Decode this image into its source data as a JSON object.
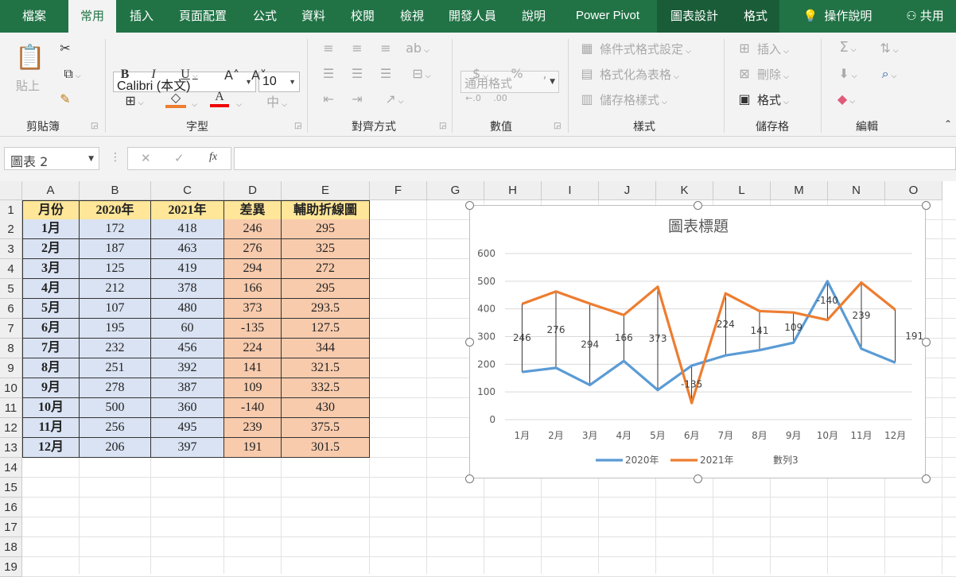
{
  "tabs": [
    "檔案",
    "常用",
    "插入",
    "頁面配置",
    "公式",
    "資料",
    "校閱",
    "檢視",
    "開發人員",
    "說明",
    "Power Pivot",
    "圖表設計",
    "格式"
  ],
  "tell_me": "操作說明",
  "share": "共用",
  "ribbon": {
    "paste": "貼上",
    "font_name": "Calibri (本文)",
    "font_size": "10",
    "number_format": "通用格式",
    "cond_format": "條件式格式設定",
    "format_table": "格式化為表格",
    "cell_styles": "儲存格樣式",
    "insert": "插入",
    "delete": "刪除",
    "format": "格式",
    "groups": [
      "剪貼簿",
      "字型",
      "對齊方式",
      "數值",
      "樣式",
      "儲存格",
      "編輯"
    ]
  },
  "namebox": "圖表 2",
  "columns": [
    "A",
    "B",
    "C",
    "D",
    "E",
    "F",
    "G",
    "H",
    "I",
    "J",
    "K",
    "L",
    "M",
    "N",
    "O"
  ],
  "rows": [
    "1",
    "2",
    "3",
    "4",
    "5",
    "6",
    "7",
    "8",
    "9",
    "10",
    "11",
    "12",
    "13",
    "14",
    "15",
    "16",
    "17",
    "18",
    "19"
  ],
  "table": {
    "headers": [
      "月份",
      "2020年",
      "2021年",
      "差異",
      "輔助折線圖"
    ],
    "data": [
      [
        "1月",
        "172",
        "418",
        "246",
        "295"
      ],
      [
        "2月",
        "187",
        "463",
        "276",
        "325"
      ],
      [
        "3月",
        "125",
        "419",
        "294",
        "272"
      ],
      [
        "4月",
        "212",
        "378",
        "166",
        "295"
      ],
      [
        "5月",
        "107",
        "480",
        "373",
        "293.5"
      ],
      [
        "6月",
        "195",
        "60",
        "-135",
        "127.5"
      ],
      [
        "7月",
        "232",
        "456",
        "224",
        "344"
      ],
      [
        "8月",
        "251",
        "392",
        "141",
        "321.5"
      ],
      [
        "9月",
        "278",
        "387",
        "109",
        "332.5"
      ],
      [
        "10月",
        "500",
        "360",
        "-140",
        "430"
      ],
      [
        "11月",
        "256",
        "495",
        "239",
        "375.5"
      ],
      [
        "12月",
        "206",
        "397",
        "191",
        "301.5"
      ]
    ]
  },
  "chart_data": {
    "type": "line",
    "title": "圖表標題",
    "categories": [
      "1月",
      "2月",
      "3月",
      "4月",
      "5月",
      "6月",
      "7月",
      "8月",
      "9月",
      "10月",
      "11月",
      "12月"
    ],
    "ylim": [
      0,
      600
    ],
    "yticks": [
      "0",
      "100",
      "200",
      "300",
      "400",
      "500",
      "600"
    ],
    "series": [
      {
        "name": "2020年",
        "color": "#5b9bd5",
        "values": [
          172,
          187,
          125,
          212,
          107,
          195,
          232,
          251,
          278,
          500,
          256,
          206
        ]
      },
      {
        "name": "2021年",
        "color": "#ed7d31",
        "values": [
          418,
          463,
          419,
          378,
          480,
          60,
          456,
          392,
          387,
          360,
          495,
          397
        ]
      },
      {
        "name": "數列3",
        "values": [
          295,
          325,
          272,
          295,
          293.5,
          127.5,
          344,
          321.5,
          332.5,
          430,
          375.5,
          301.5
        ]
      }
    ],
    "labels": [
      "246",
      "276",
      "294",
      "166",
      "373",
      "-135",
      "224",
      "141",
      "109",
      "-140",
      "239",
      "191"
    ],
    "grid": true,
    "legend": "bottom"
  }
}
